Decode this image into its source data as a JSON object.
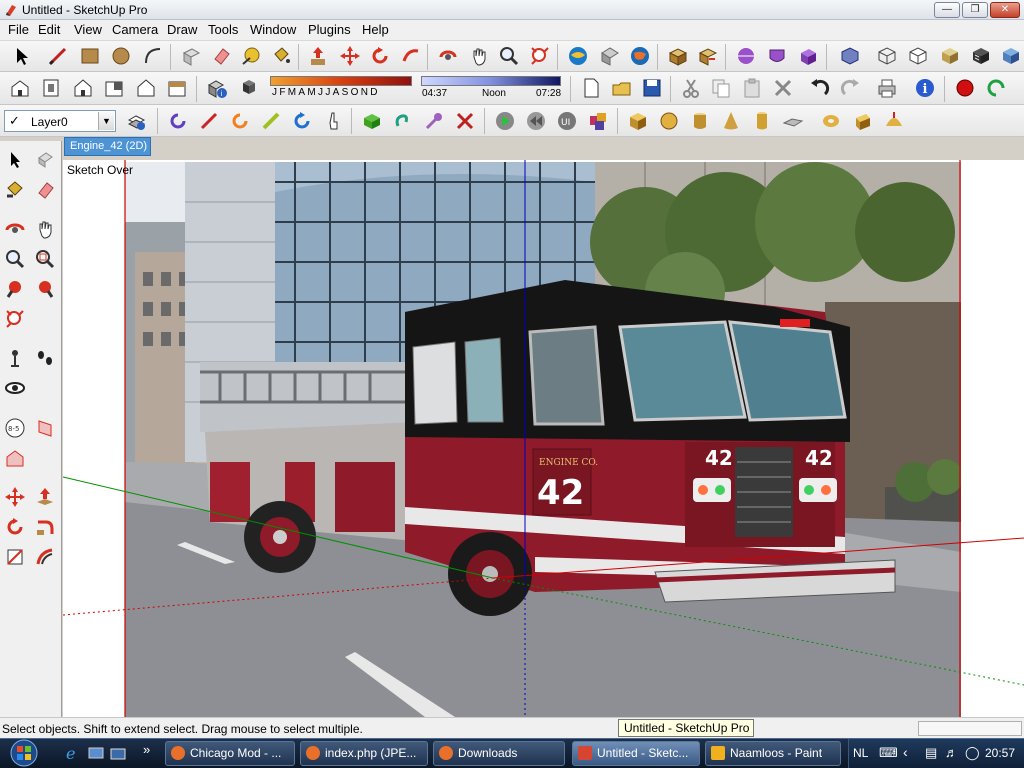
{
  "window": {
    "title": "Untitled - SketchUp Pro"
  },
  "menu": [
    "File",
    "Edit",
    "View",
    "Camera",
    "Draw",
    "Tools",
    "Window",
    "Plugins",
    "Help"
  ],
  "shadow_settings": {
    "months": [
      "J",
      "F",
      "M",
      "A",
      "M",
      "J",
      "J",
      "A",
      "S",
      "O",
      "N",
      "D"
    ],
    "time_start": "04:37",
    "time_noon": "Noon",
    "time_end": "07:28"
  },
  "layer": {
    "current": "Layer0"
  },
  "scene_tab": {
    "label": "Engine_42 (2D)"
  },
  "viewport": {
    "style_label": "Sketch Over"
  },
  "status": {
    "text": "Select objects. Shift to extend select. Drag mouse to select multiple."
  },
  "tooltip": {
    "text": "Untitled - SketchUp Pro"
  },
  "truck": {
    "unit_number": "42",
    "unit_label": "ENGINE CO."
  },
  "taskbar": {
    "items": [
      {
        "label": "Chicago Mod - ...",
        "color": "#e8702a"
      },
      {
        "label": "index.php (JPE...",
        "color": "#e8702a"
      },
      {
        "label": "Downloads",
        "color": "#e8702a"
      },
      {
        "label": "Untitled - Sketc...",
        "color": "#d64532"
      },
      {
        "label": "Naamloos - Paint",
        "color": "#f0b020"
      }
    ],
    "language": "NL",
    "clock": "20:57"
  },
  "colors": {
    "truck_red": "#8e1a2a",
    "scene_tab": "#4d94d6",
    "axis_red": "#d00000",
    "axis_green": "#009000",
    "axis_blue": "#0000c0"
  }
}
